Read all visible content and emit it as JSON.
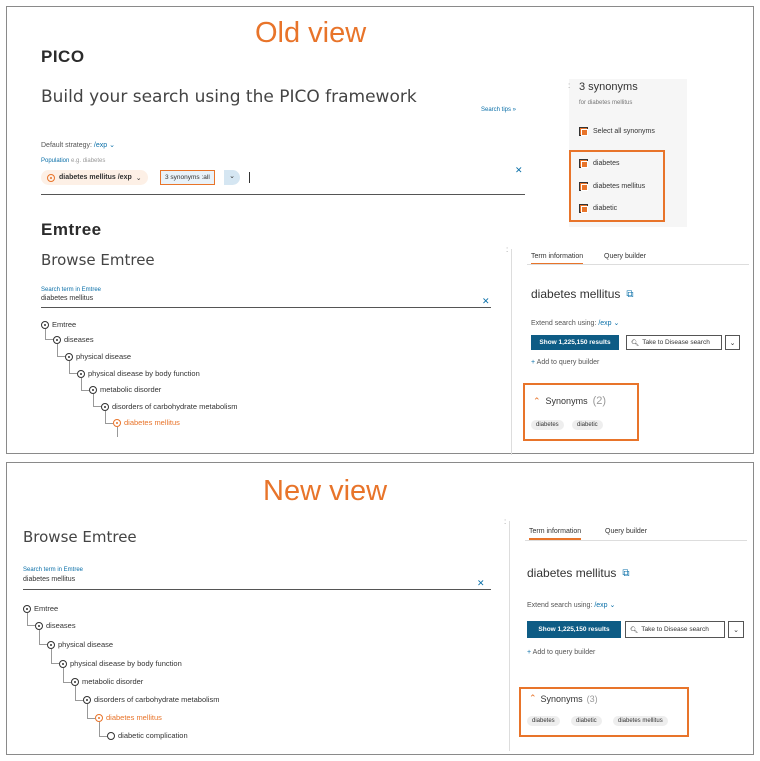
{
  "old_view": {
    "heading": "Old view",
    "pico": {
      "section_title": "PICO",
      "build_title": "Build your search using the PICO framework",
      "search_tips": "Search tips",
      "default_strategy_label": "Default strategy:",
      "default_strategy_value": "/exp",
      "population_label": "Population",
      "population_hint": "e.g. diabetes",
      "term_chip": "diabetes mellitus /exp",
      "synonyms_chip": "3 synonyms :all"
    },
    "synonym_panel": {
      "title": "3 synonyms",
      "subtitle": "for diabetes mellitus",
      "select_all": "Select all synonyms",
      "items": [
        "diabetes",
        "diabetes mellitus",
        "diabetic"
      ]
    },
    "emtree": {
      "section_title": "Emtree",
      "browse_title": "Browse Emtree",
      "search_label": "Search term in Emtree",
      "search_value": "diabetes mellitus",
      "tree": [
        "Emtree",
        "diseases",
        "physical disease",
        "physical disease by body function",
        "metabolic disorder",
        "disorders of carbohydrate metabolism",
        "diabetes mellitus"
      ]
    },
    "term_info": {
      "tab_term": "Term information",
      "tab_query": "Query builder",
      "term_title": "diabetes mellitus",
      "extend_label": "Extend search using:",
      "extend_value": "/exp",
      "show_results": "Show 1,225,150 results",
      "take_to": "Take to Disease search",
      "add_to_query": "Add to query builder",
      "synonyms_label": "Synonyms",
      "synonyms_count": "(2)",
      "synonyms": [
        "diabetes",
        "diabetic"
      ]
    }
  },
  "new_view": {
    "heading": "New view",
    "emtree": {
      "browse_title": "Browse Emtree",
      "search_label": "Search term in Emtree",
      "search_value": "diabetes mellitus",
      "tree": [
        "Emtree",
        "diseases",
        "physical disease",
        "physical disease by body function",
        "metabolic disorder",
        "disorders of carbohydrate metabolism",
        "diabetes mellitus",
        "diabetic complication"
      ]
    },
    "term_info": {
      "tab_term": "Term information",
      "tab_query": "Query builder",
      "term_title": "diabetes mellitus",
      "extend_label": "Extend search using:",
      "extend_value": "/exp",
      "show_results": "Show 1,225,150 results",
      "take_to": "Take to Disease search",
      "add_to_query": "Add to query builder",
      "synonyms_label": "Synonyms",
      "synonyms_count": "(3)",
      "synonyms": [
        "diabetes",
        "diabetic",
        "diabetes mellitus"
      ]
    }
  },
  "colors": {
    "accent": "#e8742a",
    "button": "#0e5c85",
    "link": "#0a6fa8"
  }
}
